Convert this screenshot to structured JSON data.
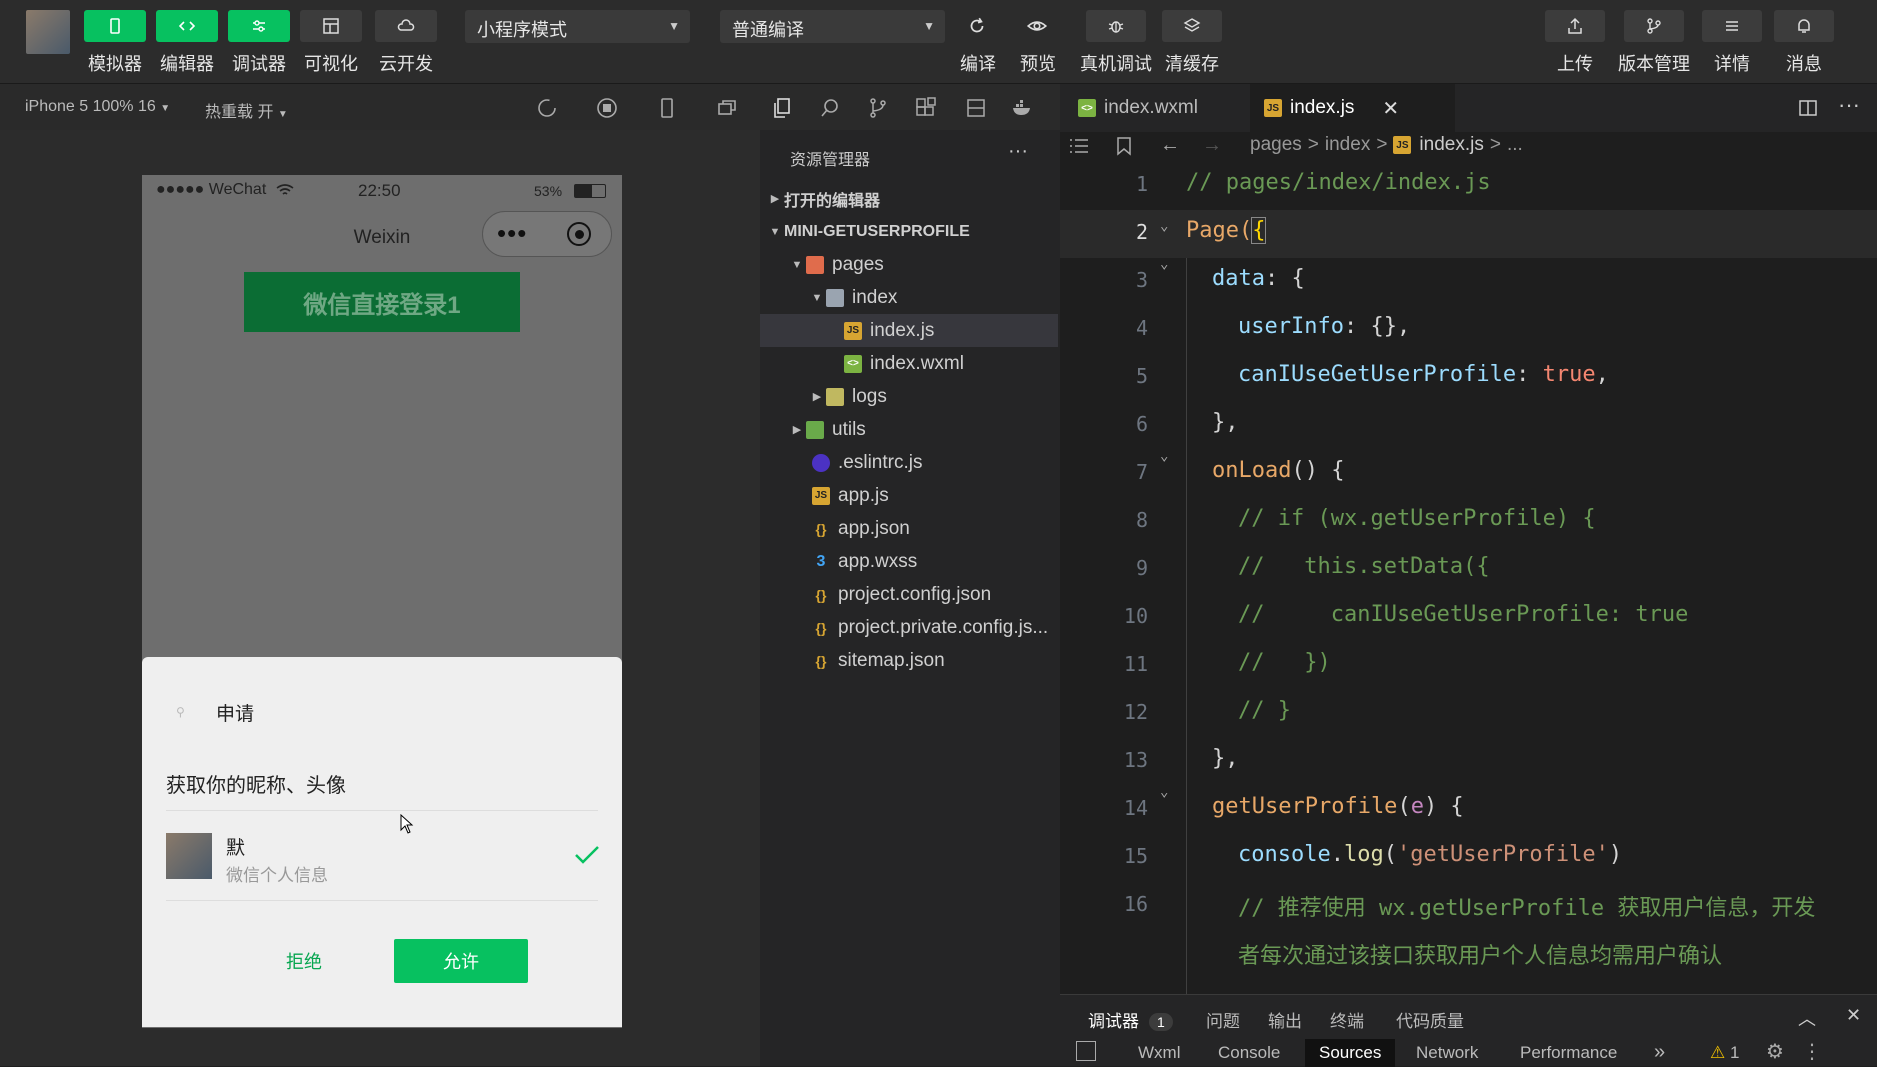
{
  "toolbar": {
    "simulator": "模拟器",
    "editor": "编辑器",
    "debugger": "调试器",
    "visual": "可视化",
    "cloud": "云开发",
    "mode_select": "小程序模式",
    "compile_select": "普通编译",
    "compile": "编译",
    "preview": "预览",
    "remote_debug": "真机调试",
    "clear_cache": "清缓存",
    "upload": "上传",
    "version": "版本管理",
    "details": "详情",
    "messages": "消息"
  },
  "subbar": {
    "device": "iPhone 5 100% 16",
    "hot_reload": "热重载 开"
  },
  "phone": {
    "signal": "●●●●● WeChat",
    "time": "22:50",
    "battery": "53%",
    "nav_title": "Weixin",
    "login_button": "微信直接登录1"
  },
  "auth_sheet": {
    "title": "申请",
    "desc": "获取你的昵称、头像",
    "user_name": "默",
    "user_sub": "微信个人信息",
    "reject": "拒绝",
    "allow": "允许"
  },
  "explorer": {
    "title": "资源管理器",
    "more": "···",
    "open_editors": "打开的编辑器",
    "project": "MINI-GETUSERPROFILE",
    "items": [
      {
        "label": "pages"
      },
      {
        "label": "index"
      },
      {
        "label": "index.js"
      },
      {
        "label": "index.wxml"
      },
      {
        "label": "logs"
      },
      {
        "label": "utils"
      },
      {
        "label": ".eslintrc.js"
      },
      {
        "label": "app.js"
      },
      {
        "label": "app.json"
      },
      {
        "label": "app.wxss"
      },
      {
        "label": "project.config.json"
      },
      {
        "label": "project.private.config.js..."
      },
      {
        "label": "sitemap.json"
      }
    ]
  },
  "tabs": [
    {
      "label": "index.wxml"
    },
    {
      "label": "index.js"
    }
  ],
  "breadcrumb": {
    "p1": "pages",
    "sep": ">",
    "p2": "index",
    "p3": "index.js",
    "p4": "..."
  },
  "code": {
    "l1": "// pages/index/index.js",
    "l2a": "Page(",
    "l2b": "{",
    "l3a": "data",
    "l3b": ": {",
    "l4a": "userInfo",
    "l4b": ": {},",
    "l5a": "canIUseGetUserProfile",
    "l5b": ": ",
    "l5c": "true",
    "l5d": ",",
    "l6": "},",
    "l7a": "onLoad",
    "l7b": "() {",
    "l8": "// if (wx.getUserProfile) {",
    "l9": "//   this.setData({",
    "l10": "//     canIUseGetUserProfile: true",
    "l11": "//   })",
    "l12": "// }",
    "l13": "},",
    "l14a": "getUserProfile",
    "l14b": "(",
    "l14c": "e",
    "l14d": ") {",
    "l15a": "console",
    "l15b": ".",
    "l15c": "log",
    "l15d": "(",
    "l15e": "'getUserProfile'",
    "l15f": ")",
    "l16a": "// 推荐使用 wx.getUserProfile 获取用户信息，开发",
    "l16b": "者每次通过该接口获取用户个人信息均需用户确认"
  },
  "bottom": {
    "debugger": "调试器",
    "badge": "1",
    "issues": "问题",
    "output": "输出",
    "terminal": "终端",
    "quality": "代码质量",
    "wxml": "Wxml",
    "console": "Console",
    "sources": "Sources",
    "network": "Network",
    "performance": "Performance",
    "more": "»",
    "warn": "1"
  }
}
